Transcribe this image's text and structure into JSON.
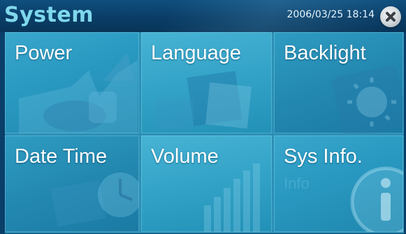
{
  "titlebar": {
    "title": "System",
    "datetime": "2006/03/25 18:14",
    "close_icon": "close-icon"
  },
  "tiles": [
    {
      "label": "Power",
      "icon": "power-plug-icon"
    },
    {
      "label": "Language",
      "icon": "language-icon"
    },
    {
      "label": "Backlight",
      "icon": "sun-icon"
    },
    {
      "label": "Date Time",
      "icon": "clock-icon"
    },
    {
      "label": "Volume",
      "icon": "volume-bars-icon"
    },
    {
      "label": "Sys Info.",
      "icon": "info-icon",
      "ghost_text": "Info"
    }
  ],
  "colors": {
    "title_text": "#7fd8ec",
    "titlebar_bg": "#0a3d66",
    "tile_bg": "#2a9ac2",
    "tile_text": "#ffffff"
  }
}
